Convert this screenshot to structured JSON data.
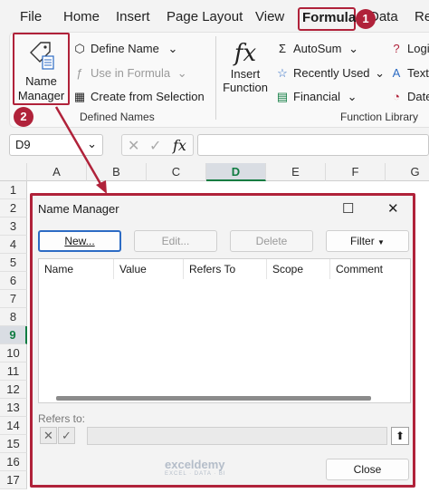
{
  "ribbon_tabs": [
    "File",
    "Home",
    "Insert",
    "Page Layout",
    "View",
    "Formulas",
    "Data",
    "Re"
  ],
  "active_tab": "Formulas",
  "callouts": {
    "one": "1",
    "two": "2"
  },
  "defined_names": {
    "name_manager_line1": "Name",
    "name_manager_line2": "Manager",
    "define_name": "Define Name",
    "use_in_formula": "Use in Formula",
    "create_from_selection": "Create from Selection",
    "group_label": "Defined Names"
  },
  "function_library": {
    "insert_function_line1": "Insert",
    "insert_function_line2": "Function",
    "autosum": "AutoSum",
    "recently_used": "Recently Used",
    "financial": "Financial",
    "logical": "Logi",
    "text": "Text",
    "date": "Date",
    "group_label": "Function Library"
  },
  "formula_bar": {
    "name_box": "D9",
    "fx": "fx",
    "value": ""
  },
  "grid": {
    "columns": [
      "A",
      "B",
      "C",
      "D",
      "E",
      "F",
      "G"
    ],
    "rows": [
      "1",
      "2",
      "3",
      "4",
      "5",
      "6",
      "7",
      "8",
      "9",
      "10",
      "11",
      "12",
      "13",
      "14",
      "15",
      "16",
      "17"
    ],
    "selected_column": "D",
    "selected_row": "9"
  },
  "dialog": {
    "title": "Name Manager",
    "maximize_icon": "☐",
    "close_icon": "✕",
    "buttons": {
      "new": "New...",
      "edit": "Edit...",
      "delete": "Delete",
      "filter": "Filter"
    },
    "columns": [
      "Name",
      "Value",
      "Refers To",
      "Scope",
      "Comment"
    ],
    "refers_to_label": "Refers to:",
    "refers_to_value": "",
    "close_button": "Close"
  },
  "watermark": {
    "brand": "exceldemy",
    "tagline": "EXCEL · DATA · BI"
  },
  "colors": {
    "callout": "#b0223a",
    "excel_green": "#107c41",
    "focus_blue": "#2c6bc4"
  }
}
